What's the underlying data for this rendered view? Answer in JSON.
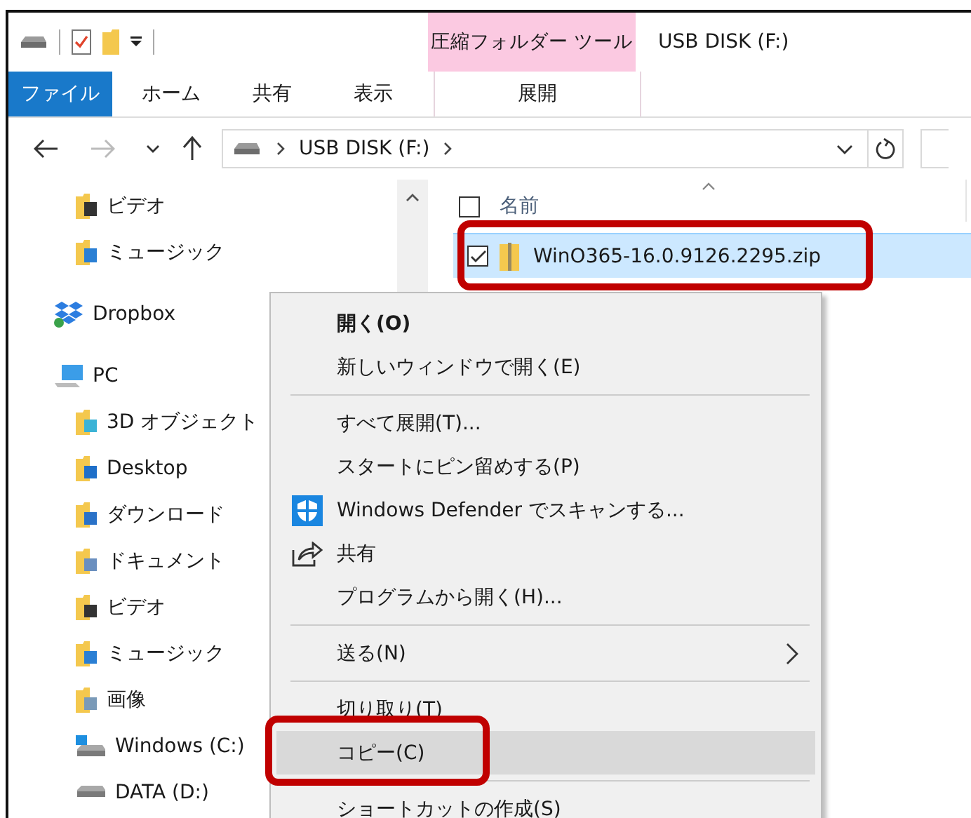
{
  "window": {
    "title": "USB DISK (F:)"
  },
  "contextual_group": {
    "label": "圧縮フォルダー ツール"
  },
  "ribbon_tabs": [
    {
      "label": "ファイル",
      "kind": "file",
      "selected": false
    },
    {
      "label": "ホーム",
      "kind": "tab",
      "selected": false
    },
    {
      "label": "共有",
      "kind": "tab",
      "selected": false
    },
    {
      "label": "表示",
      "kind": "tab",
      "selected": false
    },
    {
      "label": "展開",
      "kind": "contextual",
      "selected": false
    }
  ],
  "address_bar": {
    "path": [
      "USB DISK (F:)"
    ]
  },
  "navigation": {
    "partial_group": [
      {
        "label": "ビデオ",
        "kind": "video"
      },
      {
        "label": "ミュージック",
        "kind": "music"
      }
    ],
    "items": [
      {
        "label": "Dropbox",
        "kind": "dropbox"
      },
      {
        "label": "PC",
        "kind": "pc",
        "children": [
          {
            "label": "3D オブジェクト",
            "kind": "objects"
          },
          {
            "label": "Desktop",
            "kind": "desktop"
          },
          {
            "label": "ダウンロード",
            "kind": "download"
          },
          {
            "label": "ドキュメント",
            "kind": "documents"
          },
          {
            "label": "ビデオ",
            "kind": "video"
          },
          {
            "label": "ミュージック",
            "kind": "music"
          },
          {
            "label": "画像",
            "kind": "pictures"
          },
          {
            "label": "Windows (C:)",
            "kind": "system"
          },
          {
            "label": "DATA (D:)",
            "kind": "drive"
          }
        ]
      }
    ]
  },
  "file_list": {
    "select_all_checked": false,
    "columns": [
      {
        "label": "名前",
        "sorted": true
      }
    ],
    "rows": [
      {
        "name": "WinO365-16.0.9126.2295.zip",
        "selected": true,
        "checked": true,
        "annotated": true
      }
    ]
  },
  "context_menu": [
    {
      "kind": "item",
      "label": "開く(O)",
      "bold": true
    },
    {
      "kind": "item",
      "label": "新しいウィンドウで開く(E)"
    },
    {
      "kind": "separator"
    },
    {
      "kind": "item",
      "label": "すべて展開(T)..."
    },
    {
      "kind": "item",
      "label": "スタートにピン留めする(P)"
    },
    {
      "kind": "scan",
      "label": "Windows Defender でスキャンする..."
    },
    {
      "kind": "share",
      "label": "共有"
    },
    {
      "kind": "item",
      "label": "プログラムから開く(H)..."
    },
    {
      "kind": "separator"
    },
    {
      "kind": "item",
      "label": "送る(N)",
      "submenu": true
    },
    {
      "kind": "separator"
    },
    {
      "kind": "item",
      "label": "切り取り(T)"
    },
    {
      "kind": "item",
      "label": "コピー(C)",
      "selected": true,
      "annotated": true
    },
    {
      "kind": "separator"
    },
    {
      "kind": "item",
      "label": "ショートカットの作成(S)"
    }
  ]
}
